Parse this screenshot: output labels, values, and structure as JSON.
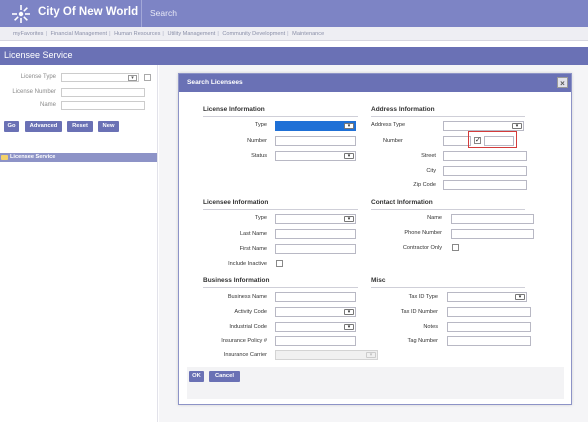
{
  "header": {
    "app_title": "City Of New World",
    "search_label": "Search"
  },
  "nav": [
    "myFavorites",
    "Financial Management",
    "Human Resources",
    "Utility Management",
    "Community Development",
    "Maintenance"
  ],
  "page_title": "Licensee Service",
  "left_form": {
    "license_type_label": "License Type",
    "license_number_label": "License Number",
    "name_label": "Name",
    "buttons": {
      "go": "Go",
      "advanced": "Advanced",
      "reset": "Reset",
      "new": "New"
    }
  },
  "tree": {
    "item": "Licensee Service"
  },
  "modal": {
    "title": "Search Licensees",
    "close": "×",
    "license_info": {
      "heading": "License Information",
      "type": "Type",
      "number": "Number",
      "status": "Status"
    },
    "address_info": {
      "heading": "Address Information",
      "address_type": "Address Type",
      "number": "Number",
      "street": "Street",
      "city": "City",
      "zip": "Zip Code"
    },
    "licensee_info": {
      "heading": "Licensee Information",
      "type": "Type",
      "last_name": "Last Name",
      "first_name": "First Name",
      "include_inactive": "Include Inactive"
    },
    "contact_info": {
      "heading": "Contact Information",
      "name": "Name",
      "phone": "Phone Number",
      "contractor_only": "Contractor Only"
    },
    "business_info": {
      "heading": "Business Information",
      "business_name": "Business Name",
      "activity_code": "Activity Code",
      "industrial_code": "Industrial Code",
      "insurance_policy": "Insurance Policy #",
      "insurance_carrier": "Insurance Carrier"
    },
    "misc": {
      "heading": "Misc",
      "tax_id_type": "Tax ID Type",
      "tax_id_number": "Tax ID Number",
      "notes": "Notes",
      "tag_number": "Tag Number"
    },
    "buttons": {
      "ok": "OK",
      "cancel": "Cancel"
    }
  },
  "colors": {
    "header": "#7d84c5",
    "accent": "#6a71b5",
    "highlight": "#d33b3b",
    "selected": "#1f70d6"
  }
}
